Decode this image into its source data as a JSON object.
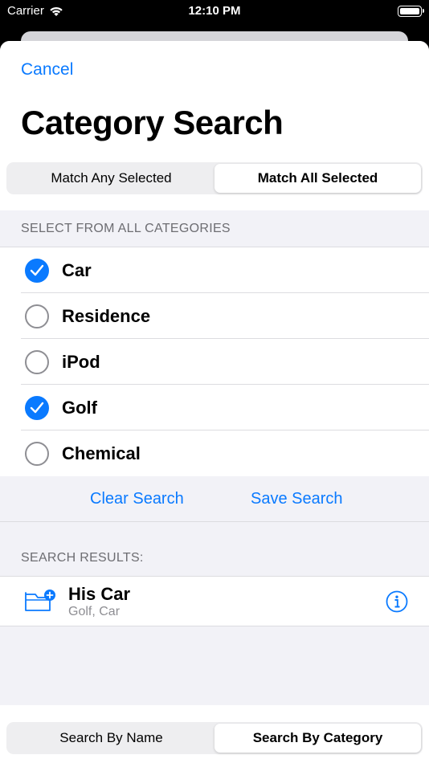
{
  "status_bar": {
    "carrier": "Carrier",
    "time": "12:10 PM"
  },
  "header": {
    "cancel_label": "Cancel",
    "title": "Category Search"
  },
  "match_mode": {
    "options": [
      "Match Any Selected",
      "Match All Selected"
    ],
    "selected": "Match All Selected"
  },
  "categories_section": {
    "header": "SELECT FROM ALL CATEGORIES",
    "items": [
      {
        "label": "Car",
        "checked": true
      },
      {
        "label": "Residence",
        "checked": false
      },
      {
        "label": "iPod",
        "checked": false
      },
      {
        "label": "Golf",
        "checked": true
      },
      {
        "label": "Chemical",
        "checked": false
      }
    ]
  },
  "actions": {
    "clear_label": "Clear Search",
    "save_label": "Save Search"
  },
  "results_section": {
    "header": "SEARCH RESULTS:",
    "items": [
      {
        "title": "His Car",
        "subtitle": "Golf, Car"
      }
    ]
  },
  "bottom_tabs": {
    "options": [
      "Search By Name",
      "Search By Category"
    ],
    "selected": "Search By Category"
  },
  "colors": {
    "accent": "#0a7aff",
    "secondary_text": "#8e8e93",
    "grouped_background": "#f2f2f7"
  }
}
